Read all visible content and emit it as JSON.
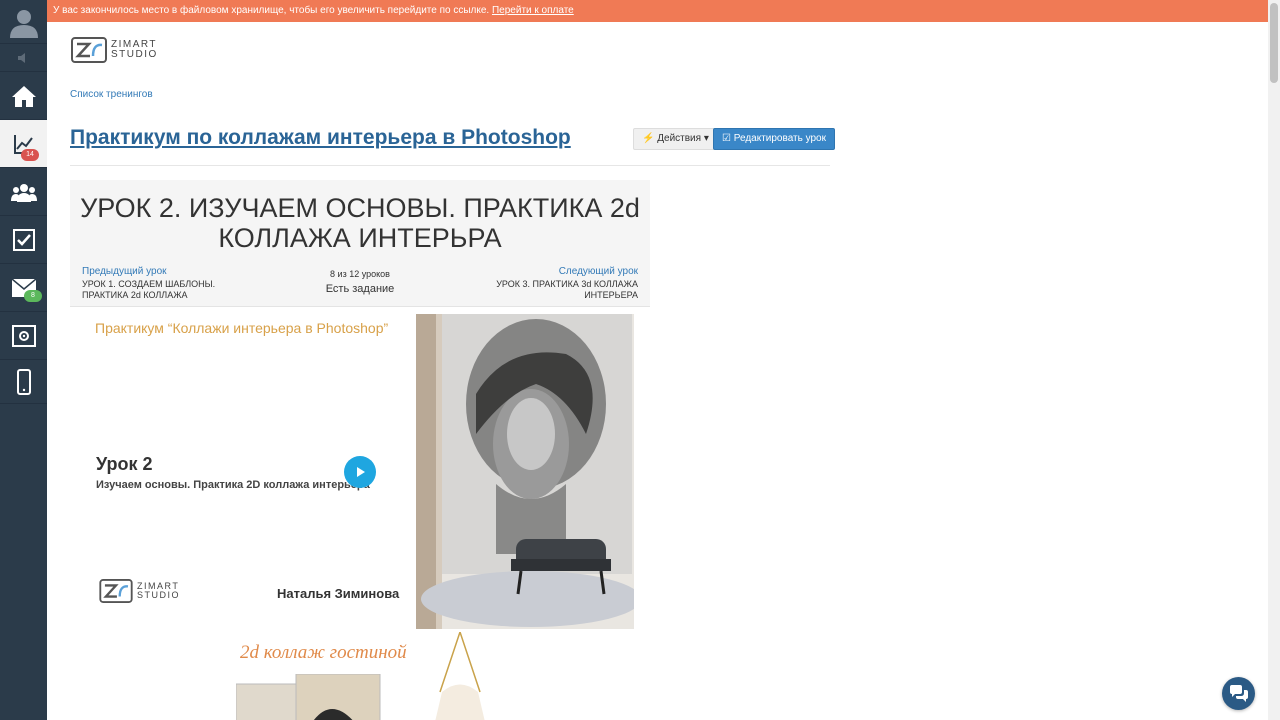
{
  "banner": {
    "text": "У вас закончилось место в файловом хранилище, чтобы его увеличить перейдите по ссылке.",
    "link": "Перейти к оплате"
  },
  "sidebar": {
    "items": [
      {
        "icon": "user-avatar-icon"
      },
      {
        "icon": "sound-icon"
      },
      {
        "icon": "home-icon"
      },
      {
        "icon": "chart-icon",
        "badge": "14"
      },
      {
        "icon": "users-icon"
      },
      {
        "icon": "checkbox-icon"
      },
      {
        "icon": "mail-icon",
        "badge": "8"
      },
      {
        "icon": "safe-icon"
      },
      {
        "icon": "mobile-icon"
      }
    ]
  },
  "logo": {
    "line1": "ZIMART",
    "line2": "STUDIO"
  },
  "breadcrumb": "Список тренингов",
  "page_title": "Практикум по коллажам интерьера в Photoshop",
  "toolbar": {
    "actions_label": "Действия",
    "edit_label": "Редактировать урок"
  },
  "lesson": {
    "title": "УРОК 2. ИЗУЧАЕМ ОСНОВЫ. ПРАКТИКА 2d КОЛЛАЖА ИНТЕРЬРА",
    "prev_label": "Предыдущий урок",
    "prev_name": "УРОК 1. СОЗДАЕМ ШАБЛОНЫ. ПРАКТИКА 2d КОЛЛАЖА",
    "counter": "8 из 12 уроков",
    "task": "Есть задание",
    "next_label": "Следующий урок",
    "next_name": "УРОК 3. ПРАКТИКА 3d КОЛЛАЖА ИНТЕРЬЕРА"
  },
  "video": {
    "title": "Практикум “Коллажи интерьера в Photoshop”",
    "lesson": "Урок 2",
    "subtitle": "Изучаем основы. Практика 2D коллажа интерьера",
    "author": "Наталья Зиминова",
    "caption": "2d коллаж гостиной"
  },
  "colors": {
    "banner": "#f07a55",
    "sidebar": "#2b3b4a",
    "link": "#337ab7",
    "accent": "#1fa6e0"
  }
}
